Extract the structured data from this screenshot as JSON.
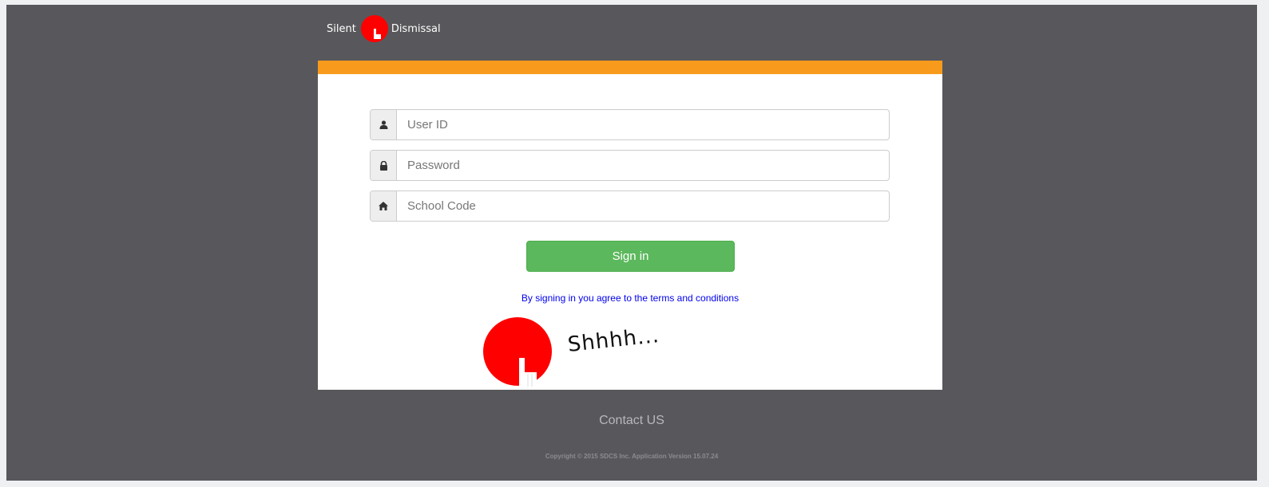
{
  "brand": {
    "name_left": "Silent",
    "name_right": "Dismissal",
    "accent_color": "#ff0000",
    "bar_color": "#f89b1c"
  },
  "login": {
    "user_id_placeholder": "User ID",
    "password_placeholder": "Password",
    "school_code_placeholder": "School Code",
    "user_icon": "user-icon",
    "lock_icon": "lock-icon",
    "home_icon": "home-icon",
    "sign_in_label": "Sign in",
    "sign_in_color": "#5cb85c",
    "terms_text": "By signing in you agree to the terms and conditions"
  },
  "mascot": {
    "text": "Shhhh..."
  },
  "footer": {
    "contact_label": "Contact US",
    "copyright": "Copyright © 2015 SDCS Inc. Application Version 15.07.24"
  }
}
